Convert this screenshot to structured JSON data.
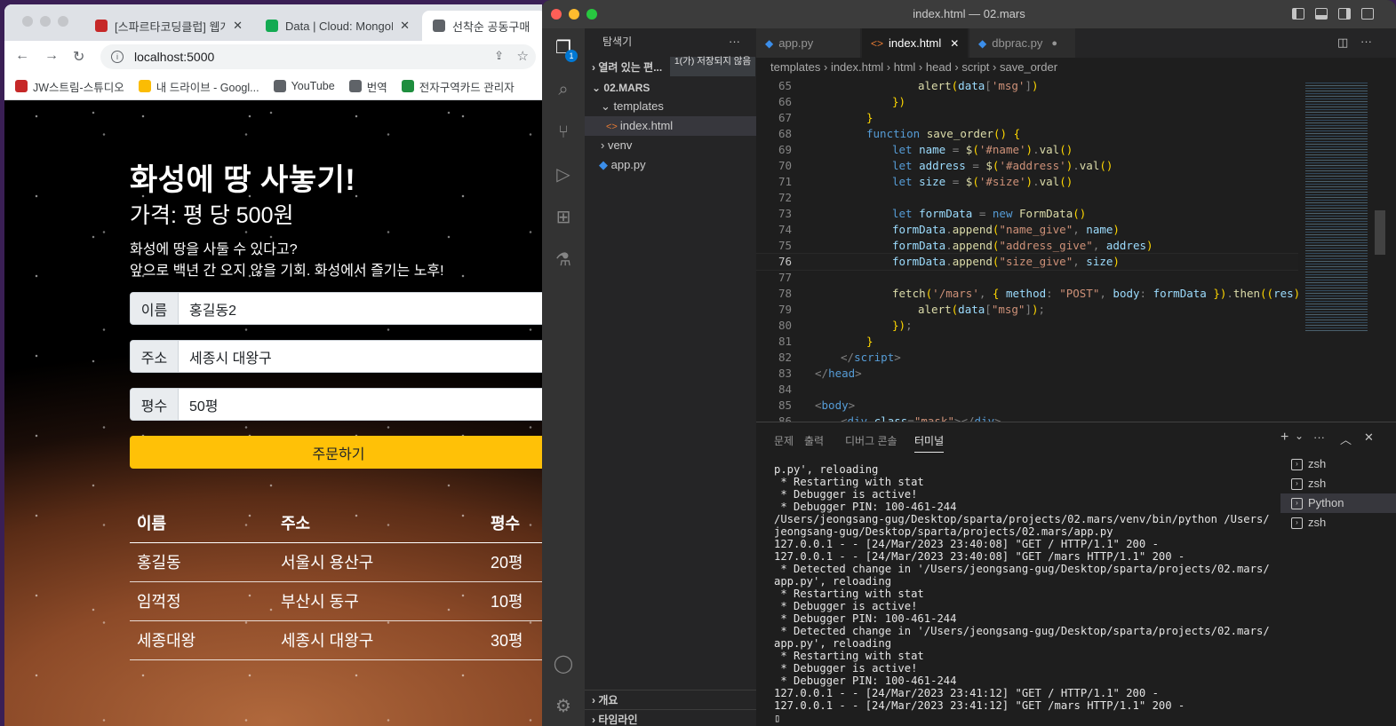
{
  "browser": {
    "tabs": [
      {
        "title": "[스파르타코딩클럽] 웹개발",
        "close": "✕",
        "icon_color": "#c62828"
      },
      {
        "title": "Data | Cloud: MongoDB",
        "close": "✕",
        "icon_color": "#13aa52"
      },
      {
        "title": "선착순 공동구매",
        "close": "",
        "icon_color": "#5f6368"
      }
    ],
    "url": "localhost:5000",
    "bookmarks": [
      {
        "label": "JW스트림-스튜디오",
        "icon_color": "#c62828"
      },
      {
        "label": "내 드라이브 - Googl...",
        "icon_color": "#fbbc04"
      },
      {
        "label": "YouTube",
        "icon_color": "#5f6368"
      },
      {
        "label": "번역",
        "icon_color": "#5f6368"
      },
      {
        "label": "전자구역카드 관리자",
        "icon_color": "#1e8e3e"
      }
    ],
    "page": {
      "title": "화성에 땅 사놓기!",
      "price": "가격: 평 당 500원",
      "desc1": "화성에 땅을 사둘 수 있다고?",
      "desc2": "앞으로 백년 간 오지 않을 기회. 화성에서 즐기는 노후!",
      "form": {
        "name_label": "이름",
        "name_value": "홍길동2",
        "address_label": "주소",
        "address_value": "세종시 대왕구",
        "size_label": "평수",
        "size_value": "50평",
        "order_button": "주문하기"
      },
      "table": {
        "headers": [
          "이름",
          "주소",
          "평수"
        ],
        "rows": [
          [
            "홍길동",
            "서울시 용산구",
            "20평"
          ],
          [
            "임꺽정",
            "부산시 동구",
            "10평"
          ],
          [
            "세종대왕",
            "세종시 대왕구",
            "30평"
          ]
        ]
      }
    }
  },
  "vscode": {
    "window_title": "index.html — 02.mars",
    "explorer": {
      "header": "탐색기",
      "more": "···",
      "open_editors": "열려 있는 편...",
      "unsaved_badge": "1(가) 저장되지 않음",
      "project": "02.MARS",
      "items": [
        "templates",
        "index.html",
        "venv",
        "app.py"
      ],
      "outline": "개요",
      "timeline": "타임라인",
      "badge_count": "1"
    },
    "tabs": [
      {
        "label": "app.py",
        "icon": "python-icon"
      },
      {
        "label": "index.html",
        "icon": "html-icon",
        "close": "✕"
      },
      {
        "label": "dbprac.py",
        "icon": "python-icon",
        "dirty": "●"
      }
    ],
    "breadcrumb": [
      "templates",
      "index.html",
      "html",
      "head",
      "script",
      "save_order"
    ],
    "code_lines": [
      {
        "n": "65",
        "indent": 4,
        "parts": [
          [
            "fn",
            "alert"
          ],
          [
            "br",
            "("
          ],
          [
            "var",
            "data"
          ],
          [
            "pun",
            "["
          ],
          [
            "str",
            "'msg'"
          ],
          [
            "pun",
            "]"
          ],
          [
            "br",
            ")"
          ]
        ]
      },
      {
        "n": "66",
        "indent": 3,
        "parts": [
          [
            "br",
            "})"
          ]
        ]
      },
      {
        "n": "67",
        "indent": 2,
        "parts": [
          [
            "br",
            "}"
          ]
        ]
      },
      {
        "n": "68",
        "indent": 2,
        "parts": [
          [
            "kw",
            "function "
          ],
          [
            "fn",
            "save_order"
          ],
          [
            "br",
            "() {"
          ]
        ]
      },
      {
        "n": "69",
        "indent": 3,
        "parts": [
          [
            "kw",
            "let "
          ],
          [
            "var",
            "name"
          ],
          [
            "pun",
            " = "
          ],
          [
            "fn",
            "$"
          ],
          [
            "br",
            "("
          ],
          [
            "str",
            "'#name'"
          ],
          [
            "br",
            ")"
          ],
          [
            "pun",
            "."
          ],
          [
            "fn",
            "val"
          ],
          [
            "br",
            "()"
          ]
        ]
      },
      {
        "n": "70",
        "indent": 3,
        "parts": [
          [
            "kw",
            "let "
          ],
          [
            "var",
            "address"
          ],
          [
            "pun",
            " = "
          ],
          [
            "fn",
            "$"
          ],
          [
            "br",
            "("
          ],
          [
            "str",
            "'#address'"
          ],
          [
            "br",
            ")"
          ],
          [
            "pun",
            "."
          ],
          [
            "fn",
            "val"
          ],
          [
            "br",
            "()"
          ]
        ]
      },
      {
        "n": "71",
        "indent": 3,
        "parts": [
          [
            "kw",
            "let "
          ],
          [
            "var",
            "size"
          ],
          [
            "pun",
            " = "
          ],
          [
            "fn",
            "$"
          ],
          [
            "br",
            "("
          ],
          [
            "str",
            "'#size'"
          ],
          [
            "br",
            ")"
          ],
          [
            "pun",
            "."
          ],
          [
            "fn",
            "val"
          ],
          [
            "br",
            "()"
          ]
        ]
      },
      {
        "n": "72",
        "indent": 0,
        "parts": []
      },
      {
        "n": "73",
        "indent": 3,
        "parts": [
          [
            "kw",
            "let "
          ],
          [
            "var",
            "formData"
          ],
          [
            "pun",
            " = "
          ],
          [
            "kw",
            "new "
          ],
          [
            "fn",
            "FormData"
          ],
          [
            "br",
            "()"
          ]
        ]
      },
      {
        "n": "74",
        "indent": 3,
        "parts": [
          [
            "var",
            "formData"
          ],
          [
            "pun",
            "."
          ],
          [
            "fn",
            "append"
          ],
          [
            "br",
            "("
          ],
          [
            "str",
            "\"name_give\""
          ],
          [
            "pun",
            ", "
          ],
          [
            "var",
            "name"
          ],
          [
            "br",
            ")"
          ]
        ]
      },
      {
        "n": "75",
        "indent": 3,
        "parts": [
          [
            "var",
            "formData"
          ],
          [
            "pun",
            "."
          ],
          [
            "fn",
            "append"
          ],
          [
            "br",
            "("
          ],
          [
            "str",
            "\"address_give\""
          ],
          [
            "pun",
            ", "
          ],
          [
            "var",
            "addres"
          ],
          [
            "br",
            ")"
          ]
        ]
      },
      {
        "n": "76",
        "indent": 3,
        "parts": [
          [
            "var",
            "formData"
          ],
          [
            "pun",
            "."
          ],
          [
            "fn",
            "append"
          ],
          [
            "br",
            "("
          ],
          [
            "str",
            "\"size_give\""
          ],
          [
            "pun",
            ", "
          ],
          [
            "var",
            "size"
          ],
          [
            "br",
            ")"
          ]
        ]
      },
      {
        "n": "77",
        "indent": 0,
        "parts": []
      },
      {
        "n": "78",
        "indent": 3,
        "parts": [
          [
            "fn",
            "fetch"
          ],
          [
            "br",
            "("
          ],
          [
            "str",
            "'/mars'"
          ],
          [
            "pun",
            ", "
          ],
          [
            "br",
            "{ "
          ],
          [
            "var",
            "method"
          ],
          [
            "pun",
            ": "
          ],
          [
            "str",
            "\"POST\""
          ],
          [
            "pun",
            ", "
          ],
          [
            "var",
            "body"
          ],
          [
            "pun",
            ": "
          ],
          [
            "var",
            "formData"
          ],
          [
            "br",
            " })"
          ],
          [
            "pun",
            "."
          ],
          [
            "fn",
            "then"
          ],
          [
            "br",
            "(("
          ],
          [
            "var",
            "res"
          ],
          [
            "br",
            ")"
          ],
          [
            "kw",
            " =>"
          ]
        ]
      },
      {
        "n": "79",
        "indent": 4,
        "parts": [
          [
            "fn",
            "alert"
          ],
          [
            "br",
            "("
          ],
          [
            "var",
            "data"
          ],
          [
            "pun",
            "["
          ],
          [
            "str",
            "\"msg\""
          ],
          [
            "pun",
            "]"
          ],
          [
            "br",
            ")"
          ],
          [
            "pun",
            ";"
          ]
        ]
      },
      {
        "n": "80",
        "indent": 3,
        "parts": [
          [
            "br",
            "})"
          ],
          [
            "pun",
            ";"
          ]
        ]
      },
      {
        "n": "81",
        "indent": 2,
        "parts": [
          [
            "br",
            "}"
          ]
        ]
      },
      {
        "n": "82",
        "indent": 1,
        "parts": [
          [
            "pun",
            "</"
          ],
          [
            "tag",
            "script"
          ],
          [
            "pun",
            ">"
          ]
        ]
      },
      {
        "n": "83",
        "indent": 0,
        "parts": [
          [
            "pun",
            "</"
          ],
          [
            "tag",
            "head"
          ],
          [
            "pun",
            ">"
          ]
        ]
      },
      {
        "n": "84",
        "indent": 0,
        "parts": []
      },
      {
        "n": "85",
        "indent": 0,
        "parts": [
          [
            "pun",
            "<"
          ],
          [
            "tag",
            "body"
          ],
          [
            "pun",
            ">"
          ]
        ]
      },
      {
        "n": "86",
        "indent": 1,
        "parts": [
          [
            "pun",
            "<"
          ],
          [
            "tag",
            "div "
          ],
          [
            "var",
            "class"
          ],
          [
            "pun",
            "="
          ],
          [
            "str",
            "\"mask\""
          ],
          [
            "pun",
            "></"
          ],
          [
            "tag",
            "div"
          ],
          [
            "pun",
            ">"
          ]
        ]
      }
    ],
    "current_line": "76",
    "panel_tabs": [
      "문제",
      "출력",
      "디버그 콘솔",
      "터미널"
    ],
    "active_panel_tab": "터미널",
    "terminal_lines": [
      "p.py', reloading",
      " * Restarting with stat",
      " * Debugger is active!",
      " * Debugger PIN: 100-461-244",
      "/Users/jeongsang-gug/Desktop/sparta/projects/02.mars/venv/bin/python /Users/jeongsang-gug/Desktop/sparta/projects/02.mars/app.py",
      "127.0.0.1 - - [24/Mar/2023 23:40:08] \"GET / HTTP/1.1\" 200 -",
      "127.0.0.1 - - [24/Mar/2023 23:40:08] \"GET /mars HTTP/1.1\" 200 -",
      " * Detected change in '/Users/jeongsang-gug/Desktop/sparta/projects/02.mars/app.py', reloading",
      " * Restarting with stat",
      " * Debugger is active!",
      " * Debugger PIN: 100-461-244",
      " * Detected change in '/Users/jeongsang-gug/Desktop/sparta/projects/02.mars/app.py', reloading",
      " * Restarting with stat",
      " * Debugger is active!",
      " * Debugger PIN: 100-461-244",
      "127.0.0.1 - - [24/Mar/2023 23:41:12] \"GET / HTTP/1.1\" 200 -",
      "127.0.0.1 - - [24/Mar/2023 23:41:12] \"GET /mars HTTP/1.1\" 200 -",
      "▯"
    ],
    "terminals": [
      "zsh",
      "zsh",
      "Python",
      "zsh"
    ],
    "active_terminal": 2,
    "panel_actions": {
      "add": "+",
      "chevron": "⌄",
      "more": "···",
      "maximize": "︿",
      "close": "✕"
    }
  }
}
